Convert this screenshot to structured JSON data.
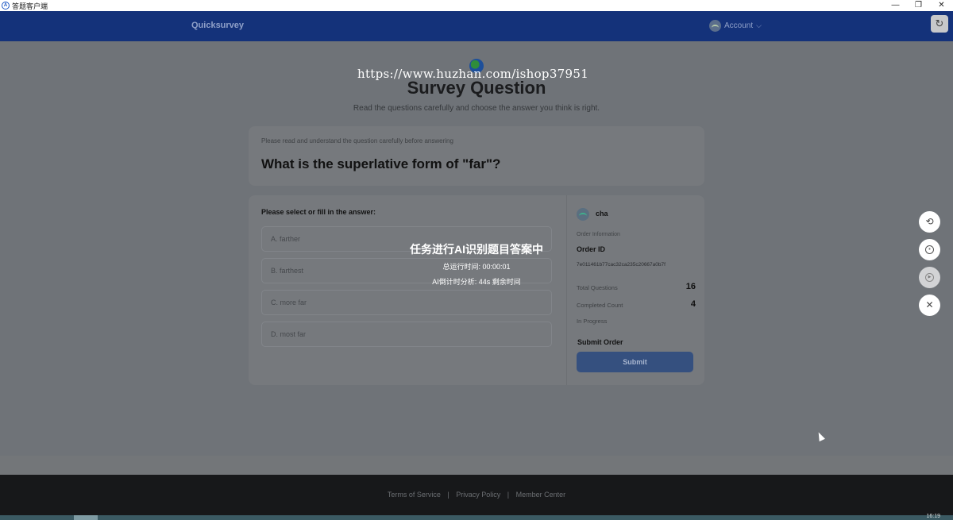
{
  "window": {
    "title": "答题客户端",
    "minimize": "—",
    "maximize": "❐",
    "close": "✕"
  },
  "header": {
    "brand": "Quicksurvey",
    "account_label": "Account",
    "account_chevron": "⌵",
    "refresh_icon": "↻"
  },
  "watermark": "https://www.huzhan.com/ishop37951",
  "page": {
    "title": "Survey Question",
    "subtitle": "Read the questions carefully and choose the answer you think is right."
  },
  "question": {
    "hint": "Please read and understand the question carefully before answering",
    "text": "What is the superlative form of \"far\"?"
  },
  "answers": {
    "prompt": "Please select or fill in the answer:",
    "options": [
      "A. farther",
      "B. farthest",
      "C. more far",
      "D. most far"
    ]
  },
  "order": {
    "user": "cha",
    "section_label": "Order Information",
    "order_id_label": "Order ID",
    "order_id": "7e011461b77cac32ca235c20667a0b7f",
    "total_questions_label": "Total Questions",
    "total_questions": "16",
    "completed_label": "Completed Count",
    "completed": "4",
    "status": "In Progress",
    "submit_label": "Submit Order",
    "submit_button": "Submit"
  },
  "overlay": {
    "title": "任务进行AI识别题目答案中",
    "runtime": "总运行时间: 00:00:01",
    "countdown": "AI倒计时分析: 44s 剩余时间"
  },
  "controls": {
    "refresh_icon": "⟲",
    "pause_icon": "⏸",
    "play_icon": "▶",
    "close_icon": "✕"
  },
  "footer": {
    "terms": "Terms of Service",
    "privacy": "Privacy Policy",
    "member": "Member Center",
    "separator": "|"
  },
  "taskbar": {
    "clock": "16:19"
  },
  "colors": {
    "header_bg": "#14327a",
    "overlay_bg": "#6f7378",
    "submit_bg": "#35507f",
    "footer_bg": "#17181a"
  }
}
